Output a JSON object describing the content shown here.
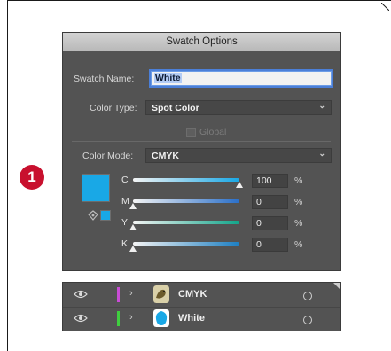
{
  "step_badge": "1",
  "dialog": {
    "title": "Swatch Options",
    "swatch_name_label": "Swatch Name:",
    "swatch_name_value": "White",
    "color_type_label": "Color Type:",
    "color_type_value": "Spot Color",
    "global_checkbox_label": "Global",
    "color_mode_label": "Color Mode:",
    "color_mode_value": "CMYK",
    "swatch_color": "#19a8e6",
    "channels": [
      {
        "label": "C",
        "value": "100",
        "unit": "%",
        "level": 1.0,
        "track_color": "#19a8e6"
      },
      {
        "label": "M",
        "value": "0",
        "unit": "%",
        "level": 0.0,
        "track_color": "#2a6fc9"
      },
      {
        "label": "Y",
        "value": "0",
        "unit": "%",
        "level": 0.0,
        "track_color": "#12a58a"
      },
      {
        "label": "K",
        "value": "0",
        "unit": "%",
        "level": 0.0,
        "track_color": "#1d7fc2"
      }
    ]
  },
  "layers_panel": {
    "rows": [
      {
        "name": "CMYK",
        "color": "#c94cd6"
      },
      {
        "name": "White",
        "color": "#3fcf3f"
      }
    ]
  }
}
